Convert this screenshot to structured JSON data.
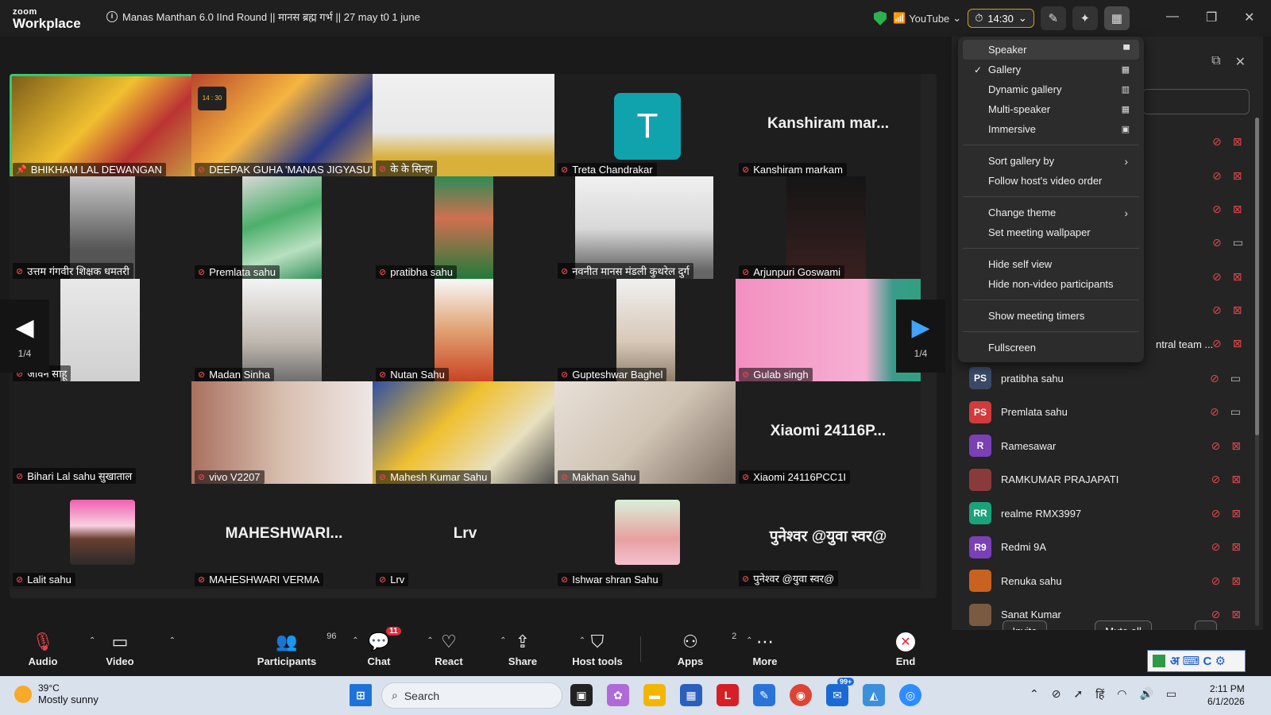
{
  "app": {
    "brand_line1": "zoom",
    "brand_line2": "Workplace",
    "meeting_title": "Manas Manthan 6.0 IInd Round || मानस ब्रह्म गर्भ || 27 may t0 1 june"
  },
  "titlebar": {
    "stream_label": "YouTube",
    "timer": "14:30"
  },
  "gallery": {
    "page_left": "1/4",
    "page_right": "1/4",
    "tiles": [
      {
        "name": "BHIKHAM LAL DEWANGAN",
        "big": ""
      },
      {
        "name": "DEEPAK GUHA 'MANAS JIGYASU'",
        "big": "",
        "timer": "14 : 30"
      },
      {
        "name": "के के सिन्हा",
        "big": ""
      },
      {
        "name": "Treta Chandrakar",
        "big": "",
        "initial": "T"
      },
      {
        "name": "Kanshiram markam",
        "big": "Kanshiram  mar..."
      },
      {
        "name": "उत्तम गंगवीर शिक्षक धमतरी",
        "big": ""
      },
      {
        "name": "Premlata sahu",
        "big": ""
      },
      {
        "name": "pratibha sahu",
        "big": ""
      },
      {
        "name": "नवनीत मानस मंडली कुथरेल दुर्ग",
        "big": ""
      },
      {
        "name": "Arjunpuri Goswami",
        "big": ""
      },
      {
        "name": "जावन साहू",
        "big": ""
      },
      {
        "name": "Madan Sinha",
        "big": ""
      },
      {
        "name": "Nutan Sahu",
        "big": ""
      },
      {
        "name": "Gupteshwar Baghel",
        "big": ""
      },
      {
        "name": "Gulab singh",
        "big": ""
      },
      {
        "name": "Bihari Lal sahu सुखाताल",
        "big": ""
      },
      {
        "name": "vivo V2207",
        "big": ""
      },
      {
        "name": "Mahesh Kumar Sahu",
        "big": ""
      },
      {
        "name": "Makhan Sahu",
        "big": ""
      },
      {
        "name": "Xiaomi 24116PCC1I",
        "big": "Xiaomi  24116P..."
      },
      {
        "name": "Lalit sahu",
        "big": ""
      },
      {
        "name": "MAHESHWARI VERMA",
        "big": "MAHESHWARI..."
      },
      {
        "name": "Lrv",
        "big": "Lrv"
      },
      {
        "name": "Ishwar shran Sahu",
        "big": ""
      },
      {
        "name": "पुनेश्वर @युवा स्वर@",
        "big": "पुनेश्वर @युवा स्वर@"
      }
    ]
  },
  "view_menu": {
    "items": [
      {
        "label": "Speaker",
        "checked": false,
        "highlight": true
      },
      {
        "label": "Gallery",
        "checked": true
      },
      {
        "label": "Dynamic gallery"
      },
      {
        "label": "Multi-speaker"
      },
      {
        "label": "Immersive"
      },
      {
        "label": "Sort gallery by"
      },
      {
        "label": "Follow host's video order"
      },
      {
        "label": "Change theme"
      },
      {
        "label": "Set meeting wallpaper"
      },
      {
        "label": "Hide self view"
      },
      {
        "label": "Hide non-video participants"
      },
      {
        "label": "Show meeting timers"
      },
      {
        "label": "Fullscreen"
      }
    ],
    "check_mark": "✓"
  },
  "participants": {
    "partial_name": "ntral team ...",
    "list": [
      {
        "initials": "PS",
        "name": "pratibha sahu",
        "color": "#3a4a66",
        "cam_on": true
      },
      {
        "initials": "PS",
        "name": "Premlata sahu",
        "color": "#d23b3b",
        "cam_on": true
      },
      {
        "initials": "R",
        "name": "Ramesawar",
        "color": "#7b3fb6",
        "cam_on": false
      },
      {
        "initials": "",
        "name": "RAMKUMAR PRAJAPATI",
        "color": "#8a3a3a",
        "cam_on": false
      },
      {
        "initials": "RR",
        "name": "realme RMX3997",
        "color": "#1aa37a",
        "cam_on": false
      },
      {
        "initials": "R9",
        "name": "Redmi 9A",
        "color": "#7b3fb6",
        "cam_on": false
      },
      {
        "initials": "",
        "name": "Renuka sahu",
        "color": "#c9621e",
        "cam_on": false
      },
      {
        "initials": "",
        "name": "Sanat Kumar",
        "color": "#7a5a40",
        "cam_on": false
      }
    ],
    "invite_label": "Invite",
    "mute_all_label": "Mute all",
    "more_label": "···"
  },
  "toolbar": {
    "audio": "Audio",
    "video": "Video",
    "participants": "Participants",
    "participants_count": "96",
    "chat": "Chat",
    "chat_badge": "11",
    "react": "React",
    "share": "Share",
    "host_tools": "Host tools",
    "apps": "Apps",
    "apps_count": "2",
    "more": "More",
    "end": "End"
  },
  "taskbar": {
    "temp": "39°C",
    "weather": "Mostly sunny",
    "search": "Search",
    "time": "2:11 PM",
    "date": "6/1/2026",
    "store_badge": "99+",
    "lang": "हिं",
    "app_l": "L"
  },
  "ime": {
    "text": "अ ⌨ C ⚙"
  }
}
